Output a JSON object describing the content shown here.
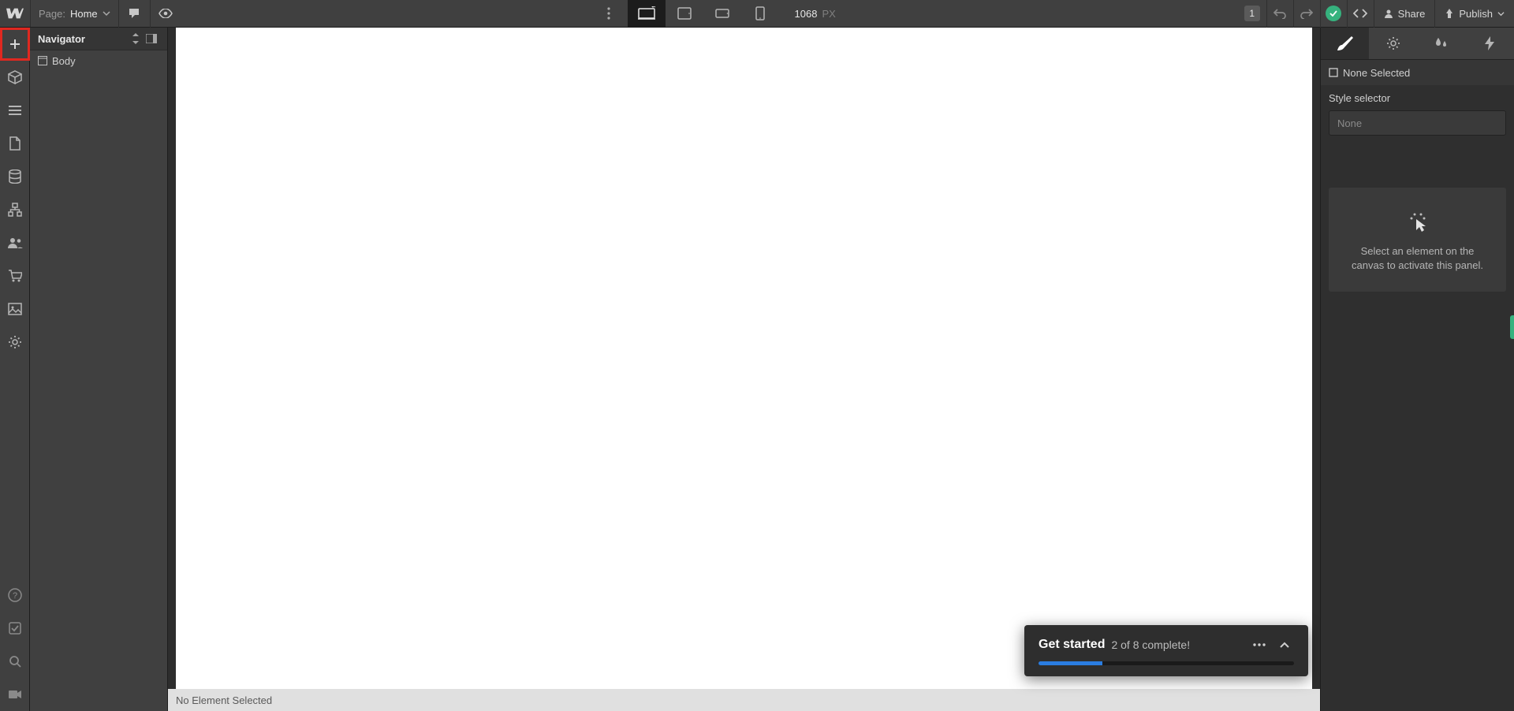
{
  "topbar": {
    "page_label": "Page:",
    "page_name": "Home",
    "canvas_width": "1068",
    "canvas_unit": "PX",
    "badge": "1",
    "share_label": "Share",
    "publish_label": "Publish"
  },
  "navigator": {
    "title": "Navigator",
    "body_label": "Body"
  },
  "status": {
    "text": "No Element Selected"
  },
  "popup": {
    "title": "Get started",
    "subtitle": "2 of 8 complete!",
    "progress_percent": 25
  },
  "rightpanel": {
    "selected_label": "None Selected",
    "style_selector_label": "Style selector",
    "selector_placeholder": "None",
    "placeholder_text": "Select an element on the canvas to activate this panel."
  }
}
